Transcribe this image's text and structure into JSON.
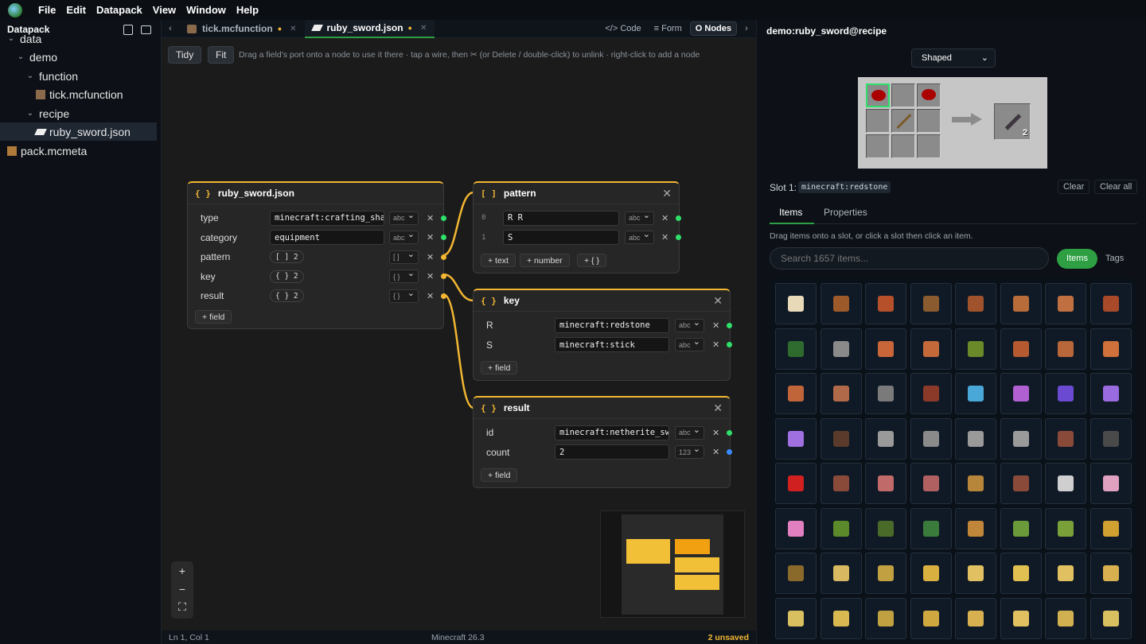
{
  "menu": [
    "File",
    "Edit",
    "Datapack",
    "View",
    "Window",
    "Help"
  ],
  "sidebar": {
    "title": "Datapack",
    "tree": [
      {
        "label": "data",
        "kind": "folder",
        "depth": 0,
        "open": true
      },
      {
        "label": "demo",
        "kind": "folder",
        "depth": 1,
        "open": true
      },
      {
        "label": "function",
        "kind": "folder",
        "depth": 2,
        "open": true
      },
      {
        "label": "tick.mcfunction",
        "kind": "mcfunction",
        "depth": 3
      },
      {
        "label": "recipe",
        "kind": "folder",
        "depth": 2,
        "open": true
      },
      {
        "label": "ruby_sword.json",
        "kind": "json",
        "depth": 3,
        "selected": true
      },
      {
        "label": "pack.mcmeta",
        "kind": "mcmeta",
        "depth": 0
      }
    ]
  },
  "tabs": [
    {
      "label": "tick.mcfunction",
      "dirty": true,
      "active": false
    },
    {
      "label": "ruby_sword.json",
      "dirty": true,
      "active": true
    }
  ],
  "view_modes": [
    "</> Code",
    "≡ Form",
    "O Nodes"
  ],
  "canvas": {
    "tidy": "Tidy",
    "fit": "Fit",
    "hint": "Drag a field's port onto a node to use it there · tap a wire, then ✂ (or Delete / double-click) to unlink · right-click to add a node"
  },
  "nodes": {
    "root": {
      "title": "ruby_sword.json",
      "bracket": "{ }",
      "fields": [
        {
          "label": "type",
          "value": "minecraft:crafting_sha",
          "type": "abc"
        },
        {
          "label": "category",
          "value": "equipment",
          "type": "abc"
        },
        {
          "label": "pattern",
          "pill": "[ ] 2",
          "type": "[ ]"
        },
        {
          "label": "key",
          "pill": "{ } 2",
          "type": "{ }"
        },
        {
          "label": "result",
          "pill": "{ } 2",
          "type": "{ }"
        }
      ],
      "add": "+ field"
    },
    "pattern": {
      "title": "pattern",
      "bracket": "[ ]",
      "items": [
        {
          "index": "0",
          "value": "R R",
          "type": "abc"
        },
        {
          "index": "1",
          "value": " S",
          "type": "abc"
        }
      ],
      "add_text": "+ text",
      "add_number": "+ number",
      "add_obj": "+ { }"
    },
    "key": {
      "title": "key",
      "bracket": "{ }",
      "fields": [
        {
          "label": "R",
          "value": "minecraft:redstone",
          "type": "abc"
        },
        {
          "label": "S",
          "value": "minecraft:stick",
          "type": "abc"
        }
      ],
      "add": "+ field"
    },
    "result": {
      "title": "result",
      "bracket": "{ }",
      "fields": [
        {
          "label": "id",
          "value": "minecraft:netherite_sw",
          "type": "abc"
        },
        {
          "label": "count",
          "value": "2",
          "type": "123"
        }
      ],
      "add": "+ field"
    }
  },
  "zoom": {
    "plus": "+",
    "minus": "−",
    "fit": "⛶"
  },
  "status": {
    "position": "Ln 1, Col 1",
    "version": "Minecraft 26.3",
    "unsaved": "2 unsaved"
  },
  "right": {
    "title": "demo:ruby_sword@recipe",
    "recipe_type": "Shaped",
    "result_count": "2",
    "slot_label": "Slot 1:",
    "slot_value": "minecraft:redstone",
    "clear": "Clear",
    "clear_all": "Clear all",
    "tabs": [
      "Items",
      "Properties"
    ],
    "help": "Drag items onto a slot, or click a slot then click an item.",
    "search_placeholder": "Search 1657 items...",
    "toggle": [
      "Items",
      "Tags"
    ],
    "palette": [
      "#e8d9b8",
      "#9c5a2b",
      "#b5502a",
      "#8a5b2e",
      "#a0522d",
      "#b86c3a",
      "#c07040",
      "#a84a2a",
      "#2f6b2f",
      "#8a8a8a",
      "#c8663a",
      "#c46a3a",
      "#6a8a2a",
      "#b55a30",
      "#b8673a",
      "#d0703a",
      "#c0653a",
      "#b06a4a",
      "#7a7a7a",
      "#8b3a2a",
      "#4aa8d8",
      "#b060d0",
      "#6a4ad0",
      "#9a6ae0",
      "#a070e0",
      "#5a3a2a",
      "#9a9a9a",
      "#8a8a8a",
      "#9a9a9a",
      "#9a9a9a",
      "#8a4a3a",
      "#4a4a4a",
      "#d02020",
      "#8a4a3a",
      "#c06a6a",
      "#b06060",
      "#b8863a",
      "#8a4a3a",
      "#cfcfcf",
      "#e0a0c0",
      "#e080c0",
      "#5a8a2a",
      "#4a6a2a",
      "#3a7a3a",
      "#c0863a",
      "#6a9a3a",
      "#7aa03a",
      "#d0a030",
      "#8a6a2a",
      "#d8b860",
      "#c0a040",
      "#d8b040",
      "#e0c060",
      "#e0c050",
      "#e0c060",
      "#d8b050",
      "#d8c060",
      "#d8b850",
      "#c0a040",
      "#d0a840",
      "#d8b050",
      "#e0c060",
      "#d0b050",
      "#d8c060"
    ]
  }
}
